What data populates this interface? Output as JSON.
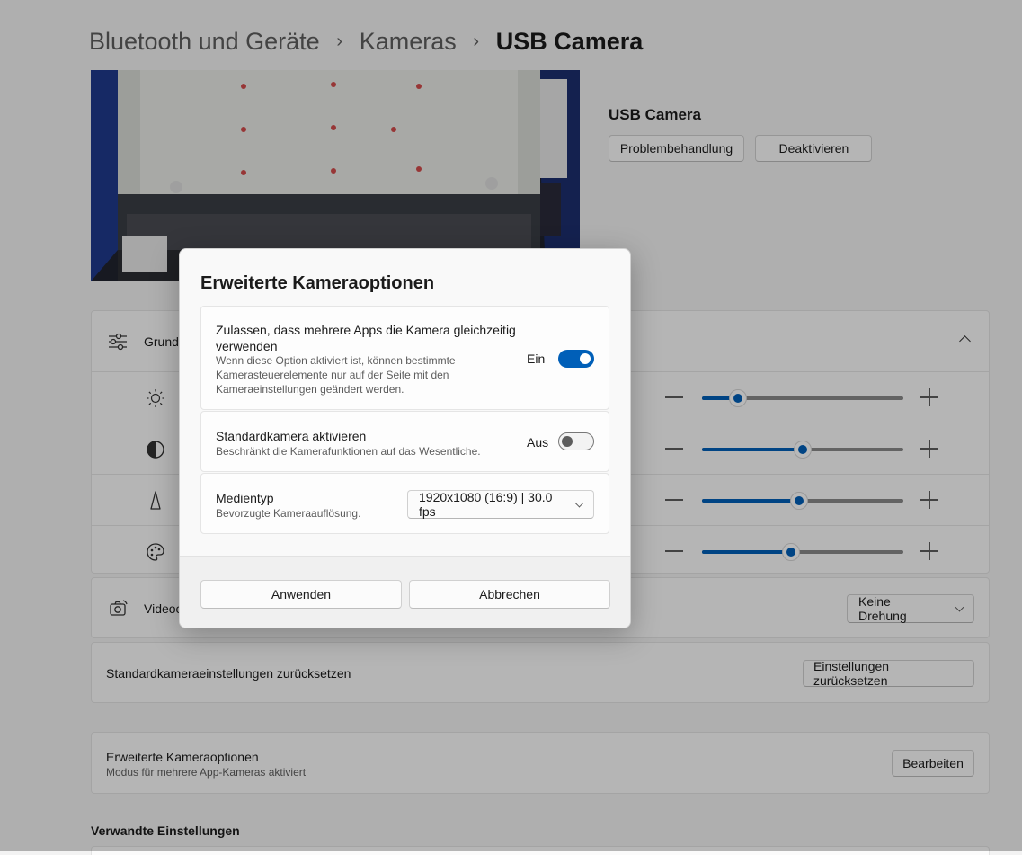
{
  "breadcrumb": {
    "items": [
      "Bluetooth und Geräte",
      "Kameras",
      "USB Camera"
    ]
  },
  "camera": {
    "name": "USB Camera",
    "troubleshoot_label": "Problembehandlung",
    "disable_label": "Deaktivieren"
  },
  "basic_settings": {
    "label_partial": "Grund",
    "rows": [
      {
        "icon": "brightness-icon",
        "level": 0.18
      },
      {
        "icon": "contrast-icon",
        "level": 0.5
      },
      {
        "icon": "sharpness-icon",
        "level": 0.48
      },
      {
        "icon": "saturation-icon",
        "level": 0.44
      }
    ]
  },
  "video_rotation": {
    "label_partial": "Videoc",
    "value": "Keine Drehung"
  },
  "reset": {
    "label": "Standardkameraeinstellungen zurücksetzen",
    "button_label": "Einstellungen zurücksetzen"
  },
  "advanced": {
    "title": "Erweiterte Kameraoptionen",
    "subtitle": "Modus für mehrere App-Kameras aktiviert",
    "button_label": "Bearbeiten"
  },
  "related": {
    "heading": "Verwandte Einstellungen"
  },
  "dialog": {
    "title": "Erweiterte Kameraoptionen",
    "multi_app": {
      "label": "Zulassen, dass mehrere Apps die Kamera gleichzeitig verwenden",
      "description": "Wenn diese Option aktiviert ist, können bestimmte Kamerasteuerelemente nur auf der Seite mit den Kameraeinstellungen geändert werden.",
      "state": "Ein",
      "on": true
    },
    "basic_camera": {
      "label": "Standardkamera aktivieren",
      "description": "Beschränkt die Kamerafunktionen auf das Wesentliche.",
      "state": "Aus",
      "on": false
    },
    "media_type": {
      "label": "Medientyp",
      "description": "Bevorzugte Kameraauflösung.",
      "value": "1920x1080 (16:9) | 30.0 fps"
    },
    "apply_label": "Anwenden",
    "cancel_label": "Abbrechen"
  },
  "colors": {
    "accent": "#005fb8",
    "background": "#f3f3f3",
    "card": "#fbfbfb"
  }
}
